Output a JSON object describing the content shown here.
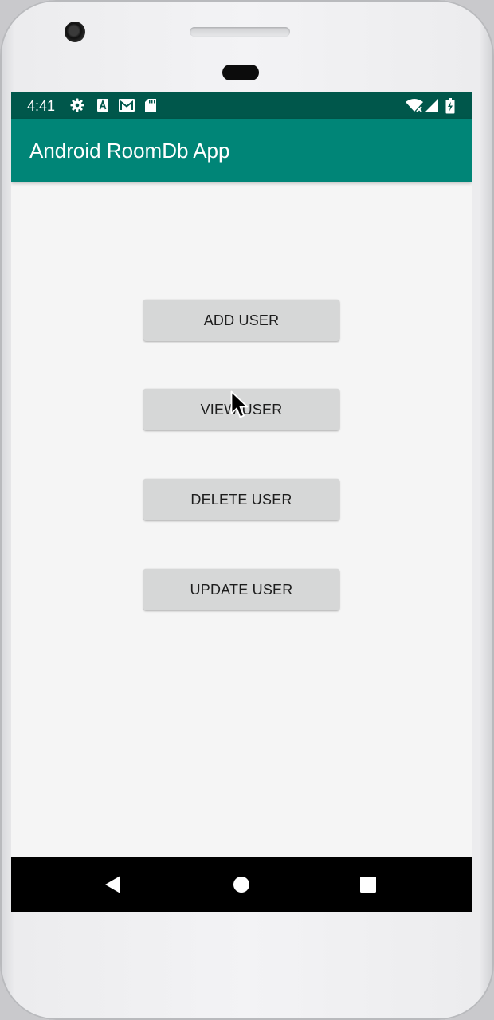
{
  "status_bar": {
    "time": "4:41",
    "left_icons": [
      "gear-icon",
      "text-a-icon",
      "gmail-icon",
      "sd-card-icon"
    ],
    "right_icons": [
      "wifi-icon",
      "cell-signal-icon",
      "battery-charging-icon"
    ]
  },
  "app_bar": {
    "title": "Android RoomDb App"
  },
  "buttons": {
    "add_user": "ADD USER",
    "view_user": "VIEW USER",
    "delete_user": "DELETE USER",
    "update_user": "UPDATE USER"
  },
  "nav_bar": {
    "icons": [
      "back-icon",
      "home-icon",
      "recents-icon"
    ]
  },
  "colors": {
    "status_bar": "#00574b",
    "app_bar": "#008577",
    "button_bg": "#d6d7d7",
    "screen_bg": "#f5f5f5"
  }
}
